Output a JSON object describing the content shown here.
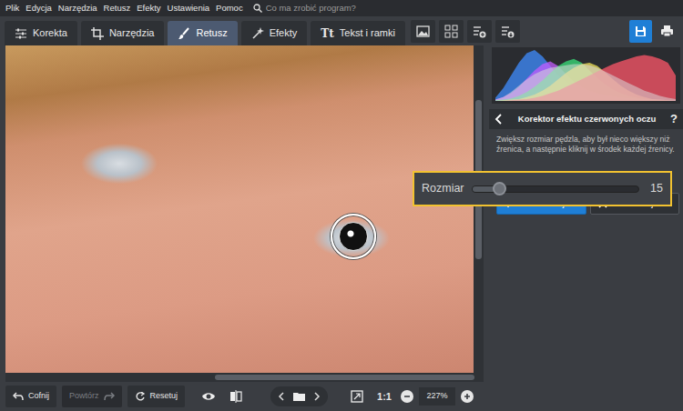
{
  "menu": {
    "items": [
      "Plik",
      "Edycja",
      "Narzędzia",
      "Retusz",
      "Efekty",
      "Ustawienia",
      "Pomoc"
    ],
    "search": {
      "placeholder": "Co ma zrobić program?"
    }
  },
  "tabs": [
    {
      "label": "Korekta",
      "selected": false
    },
    {
      "label": "Narzędzia",
      "selected": false
    },
    {
      "label": "Retusz",
      "selected": true
    },
    {
      "label": "Efekty",
      "selected": false
    },
    {
      "label": "Tekst i ramki",
      "selected": false,
      "glyph": "Tt"
    }
  ],
  "histogram": {
    "series": [
      {
        "name": "blue",
        "color": "#3f8cff",
        "values": [
          5,
          20,
          40,
          60,
          75,
          80,
          70,
          55,
          40,
          30,
          22,
          18,
          14,
          10,
          8,
          6,
          5,
          4,
          3,
          3,
          2,
          2,
          1,
          1
        ]
      },
      {
        "name": "magenta",
        "color": "#c35cff",
        "values": [
          2,
          6,
          12,
          22,
          35,
          48,
          58,
          62,
          55,
          42,
          30,
          22,
          16,
          12,
          9,
          7,
          5,
          4,
          3,
          2,
          2,
          1,
          1,
          1
        ]
      },
      {
        "name": "green",
        "color": "#39e07a",
        "values": [
          1,
          2,
          4,
          8,
          14,
          22,
          32,
          44,
          55,
          62,
          66,
          60,
          48,
          36,
          26,
          18,
          12,
          8,
          5,
          3,
          2,
          1,
          1,
          1
        ]
      },
      {
        "name": "yellow",
        "color": "#f3e45a",
        "values": [
          0,
          1,
          2,
          3,
          6,
          10,
          16,
          24,
          34,
          44,
          52,
          58,
          60,
          55,
          45,
          34,
          24,
          16,
          10,
          6,
          3,
          2,
          1,
          0
        ]
      },
      {
        "name": "red",
        "color": "#ff5668",
        "values": [
          0,
          0,
          1,
          2,
          3,
          5,
          8,
          12,
          16,
          22,
          28,
          34,
          40,
          46,
          52,
          58,
          62,
          66,
          70,
          72,
          70,
          66,
          60,
          40
        ]
      },
      {
        "name": "luminance",
        "color": "#d9d9d9",
        "values": [
          2,
          6,
          14,
          24,
          34,
          42,
          48,
          52,
          54,
          56,
          58,
          58,
          56,
          52,
          46,
          40,
          34,
          28,
          22,
          16,
          12,
          8,
          5,
          3
        ]
      }
    ]
  },
  "panel": {
    "title": "Korektor efektu czerwonych oczu",
    "help": "?",
    "description": "Zwiększ rozmiar pędzla, aby był nieco większy niż źrenica, a następnie kliknij w środek każdej źrenicy.",
    "slider": {
      "label": "Rozmiar",
      "value": "15",
      "level": 0.16
    },
    "buttons": [
      {
        "label": "Zastosuj",
        "kind": "primary"
      },
      {
        "label": "Anuluj",
        "kind": "secondary"
      }
    ]
  },
  "bottom": {
    "undo": {
      "label": "Cofnij",
      "disabled": false
    },
    "redo": {
      "label": "Powtórz",
      "disabled": true
    },
    "reset": {
      "label": "Resetuj",
      "disabled": false
    },
    "ratio": "1:1",
    "zoom": "227%"
  }
}
